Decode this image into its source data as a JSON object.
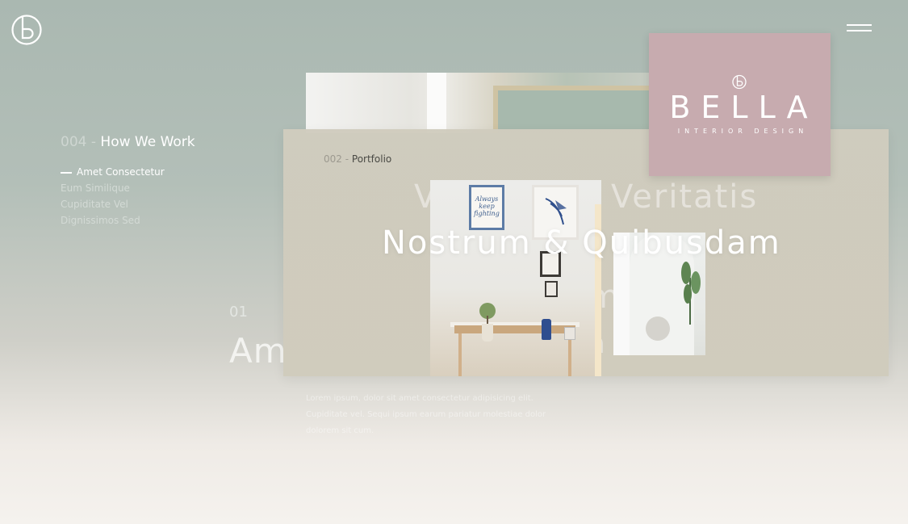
{
  "header": {
    "logo_icon": "b-monogram-logo-icon",
    "menu_icon": "hamburger-menu-icon"
  },
  "side_nav": {
    "number": "004 -",
    "title": "How We Work",
    "items": [
      {
        "label": "Amet Consectetur",
        "active": true
      },
      {
        "label": "Eum Similique",
        "active": false
      },
      {
        "label": "Cupiditate Vel",
        "active": false
      },
      {
        "label": "Dignissimos Sed",
        "active": false
      }
    ]
  },
  "background_section": {
    "number": "01",
    "heading_fragment": "Am",
    "body_text": "Lorem ipsum, dolor sit amet consectetur adipisicing elit. Cupiditate vel. Sequi ipsum earum pariatur molestiae dolor dolorem sit cum."
  },
  "portfolio_card": {
    "number": "002 -",
    "label": "Portfolio",
    "ghost_words": [
      "V",
      "Veritatis",
      "m",
      "a"
    ],
    "title": "Nostrum & Quibusdam",
    "frame_text": "Always keep fighting"
  },
  "brand_card": {
    "name": "BELLA",
    "tagline": "INTERIOR DESIGN",
    "background": "#c7abaf"
  },
  "colors": {
    "bg_top": "#aab8b1",
    "bg_bottom": "#f5f2ee",
    "card": "#d0ccbe"
  }
}
